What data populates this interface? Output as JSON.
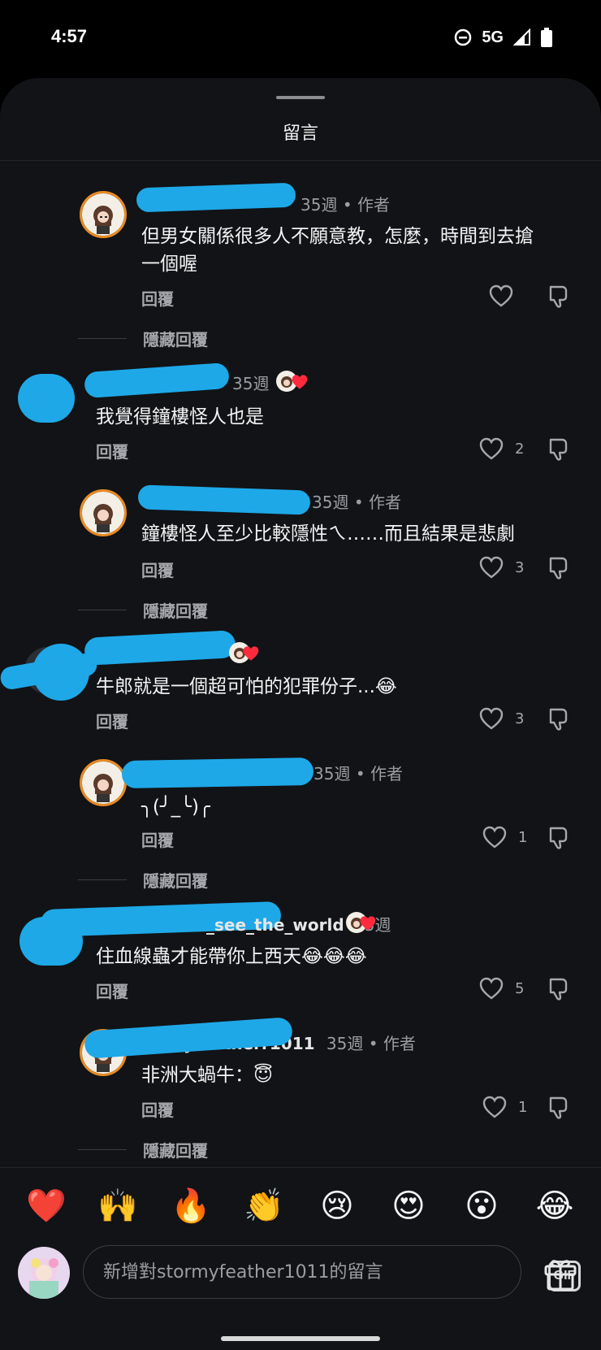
{
  "status": {
    "time": "4:57",
    "network": "5G"
  },
  "sheet": {
    "title": "留言"
  },
  "comments": [
    {
      "name": "",
      "time": "35週",
      "author_tag": "• 作者",
      "text_line1": "但男女關係很多人不願意教，怎麼，時間到去搶",
      "text_line2": "一個喔",
      "reply": "回覆",
      "hide": "隱藏回覆"
    },
    {
      "name": "",
      "time": "35週",
      "text": "我覺得鐘樓怪人也是",
      "reply": "回覆",
      "likes": "2"
    },
    {
      "name": "",
      "time": "35週",
      "author_tag": "• 作者",
      "text": "鐘樓怪人至少比較隱性ㄟ……而且結果是悲劇",
      "reply": "回覆",
      "likes": "3",
      "hide": "隱藏回覆"
    },
    {
      "name": "",
      "time": "",
      "text": "牛郎就是一個超可怕的犯罪份子...😂",
      "reply": "回覆",
      "likes": "3"
    },
    {
      "name": "",
      "time": "35週",
      "author_tag": "• 作者",
      "text": "╮(╯_╰)╭",
      "reply": "回覆",
      "likes": "1",
      "hide": "隱藏回覆"
    },
    {
      "name": "_see_the_world",
      "time": "35週",
      "text": "住血線蟲才能帶你上西天😂😂😂",
      "reply": "回覆",
      "likes": "5"
    },
    {
      "name": "yfeatherr1011",
      "time": "35週",
      "author_tag": "• 作者",
      "text": "非洲大蝸牛：😇",
      "reply": "回覆",
      "likes": "1",
      "hide": "隱藏回覆"
    }
  ],
  "emoji_bar": [
    "❤️",
    "🙌",
    "🔥",
    "👏",
    "😢",
    "😍",
    "😮",
    "😂"
  ],
  "composer": {
    "placeholder": "新增對stormyfeather1011的留言",
    "gif_label": "GIF"
  }
}
